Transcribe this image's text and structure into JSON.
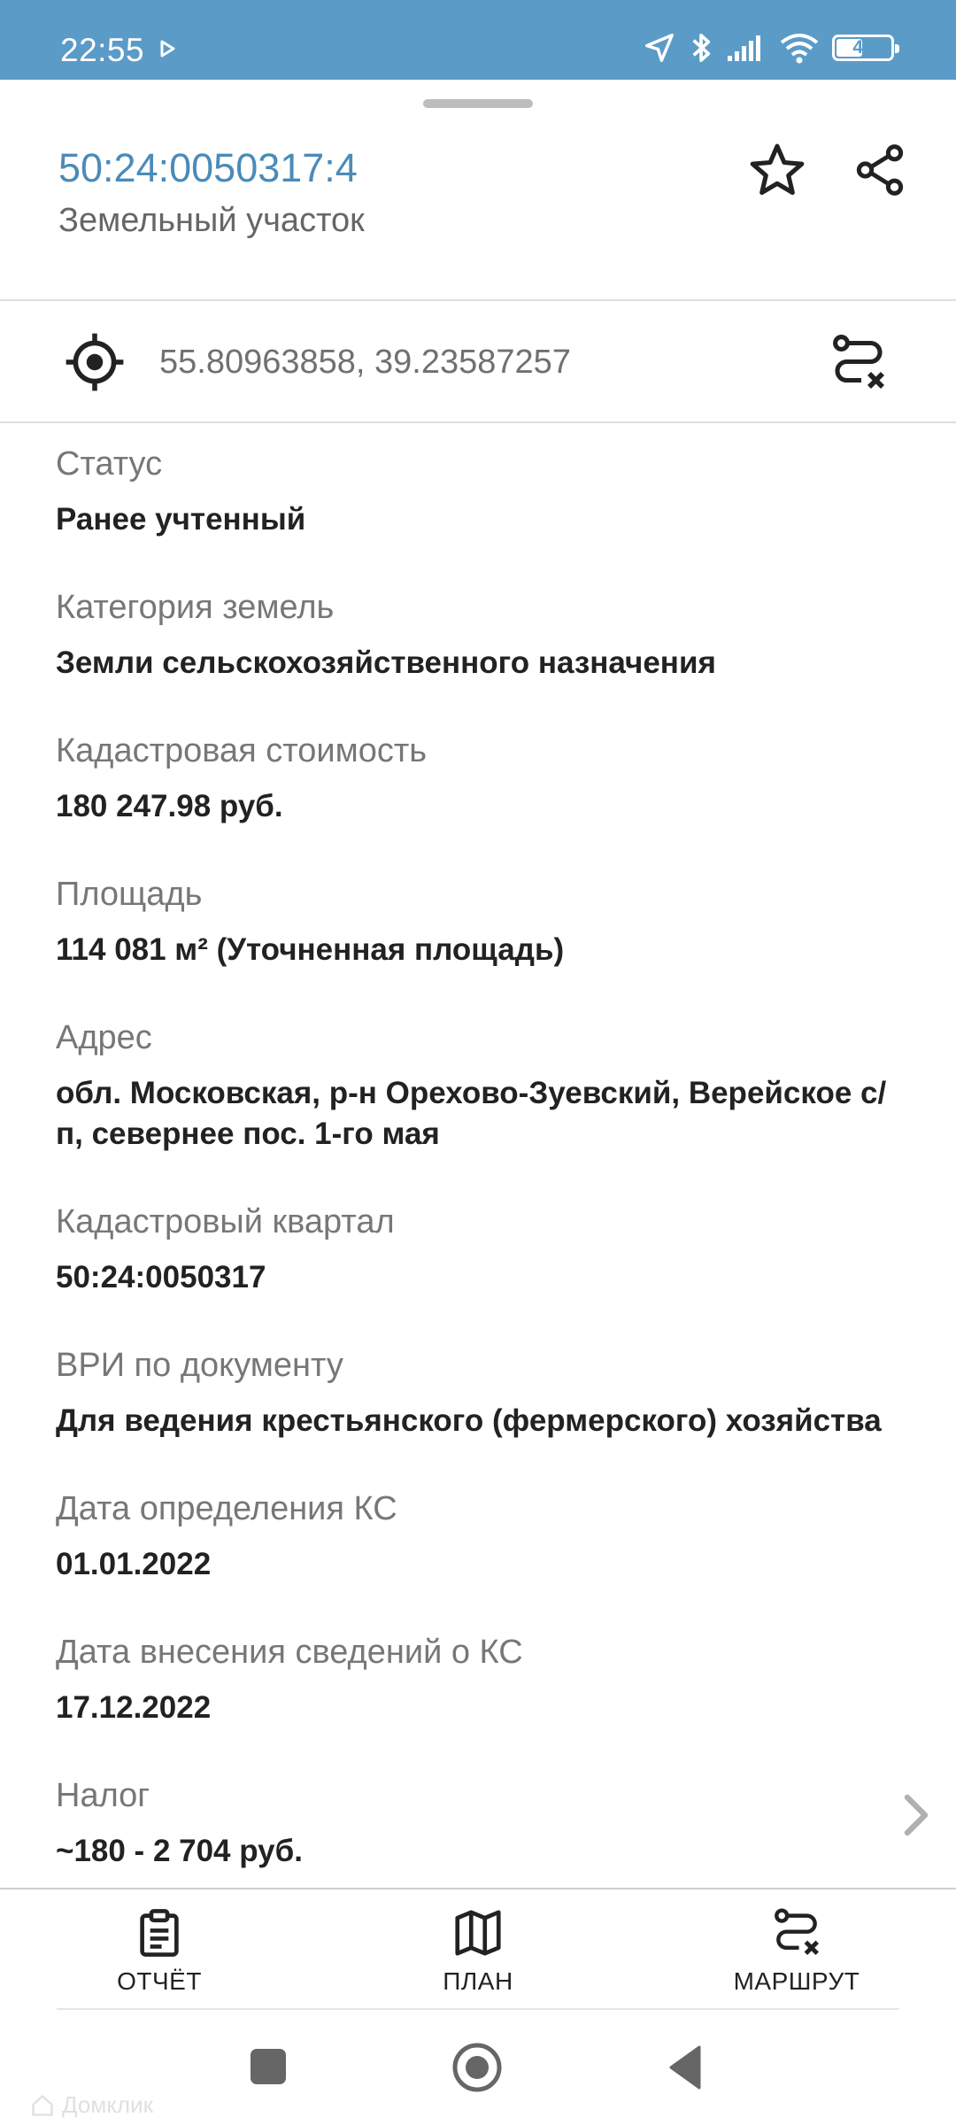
{
  "status_bar": {
    "time": "22:55",
    "battery_level": "45",
    "icons": [
      "play-icon",
      "location-arrow-icon",
      "bluetooth-icon",
      "signal-icon",
      "wifi-icon",
      "battery-icon"
    ]
  },
  "header": {
    "cadastral_number": "50:24:0050317:4",
    "object_type": "Земельный участок",
    "accent_color": "#4a8bb8"
  },
  "location": {
    "coordinates": "55.80963858, 39.23587257"
  },
  "fields": [
    {
      "label": "Статус",
      "value": "Ранее учтенный"
    },
    {
      "label": "Категория земель",
      "value": "Земли сельскохозяйственного назначения"
    },
    {
      "label": "Кадастровая стоимость",
      "value": "180 247.98 руб."
    },
    {
      "label": "Площадь",
      "value": "114 081 м² (Уточненная площадь)"
    },
    {
      "label": "Адрес",
      "value_line1": "обл. Московская, р-н Орехово-Зуевский, Верейское с/",
      "value_line2": "п, севернее пос. 1-го мая"
    },
    {
      "label": "Кадастровый квартал",
      "value": "50:24:0050317"
    },
    {
      "label": "ВРИ по документу",
      "value": "Для ведения крестьянского (фермерского) хозяйства"
    },
    {
      "label": "Дата определения КС",
      "value": "01.01.2022"
    },
    {
      "label": "Дата внесения сведений о КС",
      "value": "17.12.2022"
    },
    {
      "label": "Налог",
      "value": "~180 - 2 704 руб."
    }
  ],
  "bottom_tabs": [
    {
      "label": "ОТЧЁТ",
      "icon": "clipboard-icon"
    },
    {
      "label": "ПЛАН",
      "icon": "map-icon"
    },
    {
      "label": "МАРШРУТ",
      "icon": "route-icon"
    }
  ],
  "watermark": "Домклик"
}
